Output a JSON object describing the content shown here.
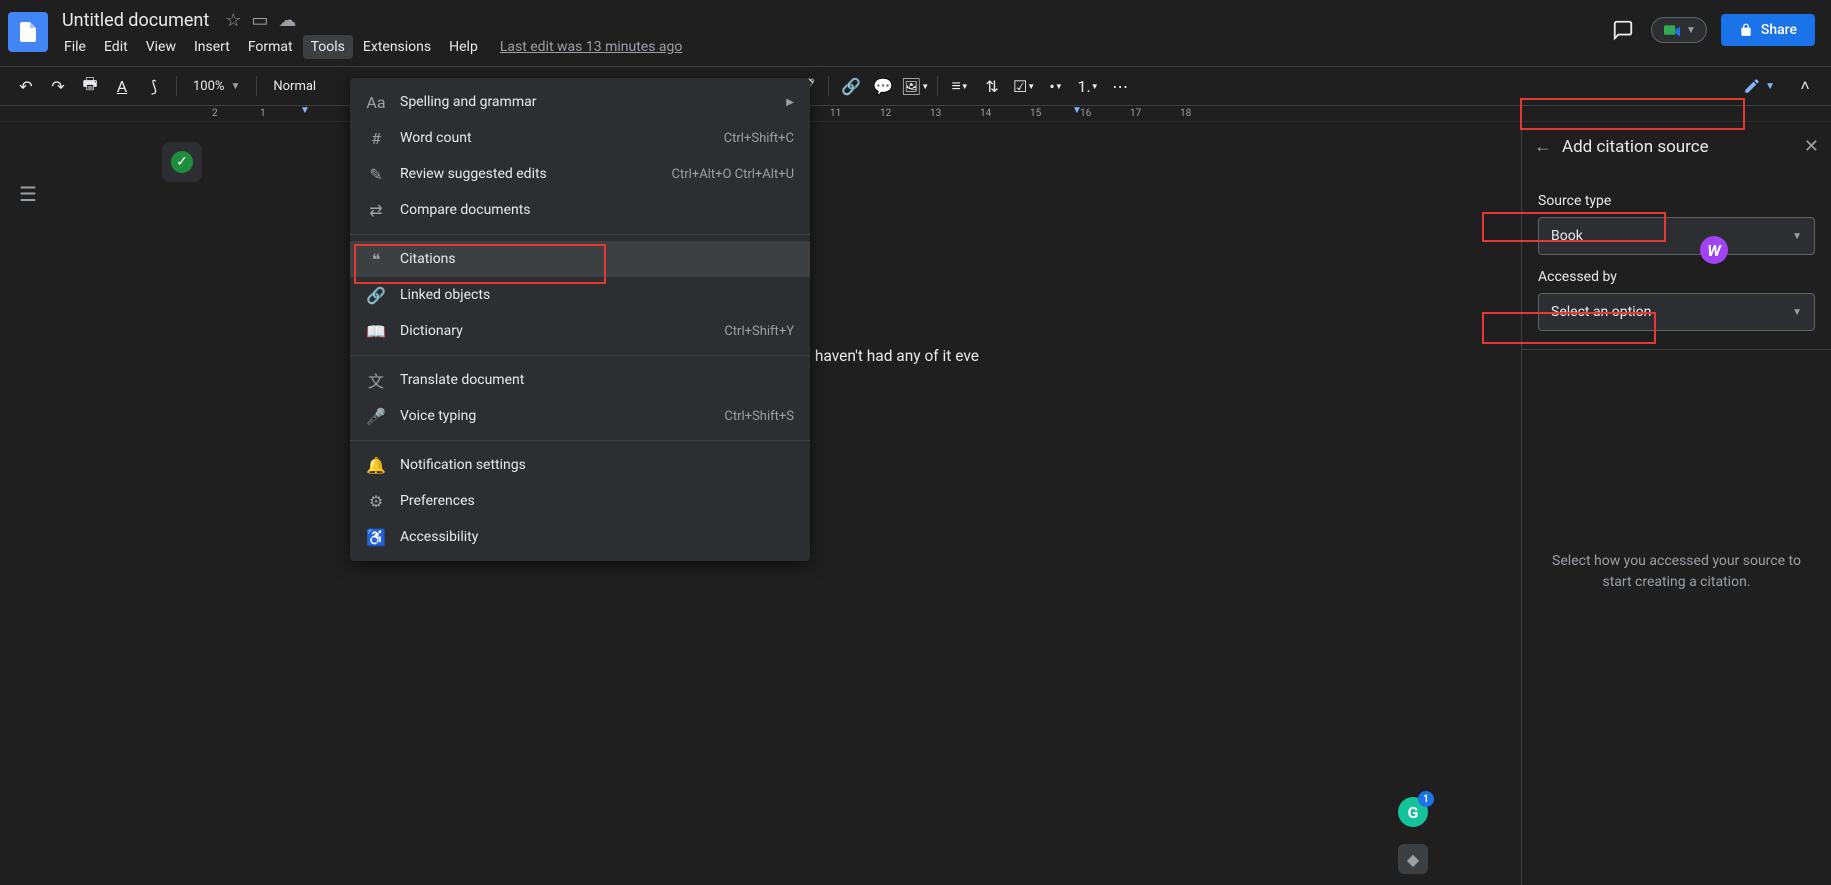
{
  "header": {
    "doc_title": "Untitled document",
    "menubar": [
      "File",
      "Edit",
      "View",
      "Insert",
      "Format",
      "Tools",
      "Extensions",
      "Help"
    ],
    "last_edit": "Last edit was 13 minutes ago",
    "share_label": "Share"
  },
  "toolbar": {
    "zoom": "100%",
    "style": "Normal"
  },
  "ruler_numbers": [
    "2",
    "1",
    "11",
    "12",
    "13",
    "14",
    "15",
    "16",
    "17",
    "18"
  ],
  "tools_menu": {
    "items": [
      {
        "icon": "Aa",
        "label": "Spelling and grammar",
        "shortcut": "",
        "arrow": true
      },
      {
        "icon": "#",
        "label": "Word count",
        "shortcut": "Ctrl+Shift+C"
      },
      {
        "icon": "✎",
        "label": "Review suggested edits",
        "shortcut": "Ctrl+Alt+O Ctrl+Alt+U"
      },
      {
        "icon": "⇄",
        "label": "Compare documents",
        "shortcut": ""
      },
      {
        "sep": true
      },
      {
        "icon": "❝",
        "label": "Citations",
        "shortcut": "",
        "highlight": true
      },
      {
        "icon": "🔗",
        "label": "Linked objects",
        "shortcut": ""
      },
      {
        "icon": "📖",
        "label": "Dictionary",
        "shortcut": "Ctrl+Shift+Y"
      },
      {
        "sep": true
      },
      {
        "icon": "文",
        "label": "Translate document",
        "shortcut": ""
      },
      {
        "icon": "🎤",
        "label": "Voice typing",
        "shortcut": "Ctrl+Shift+S"
      },
      {
        "sep": true
      },
      {
        "icon": "🔔",
        "label": "Notification settings",
        "shortcut": ""
      },
      {
        "icon": "⚙",
        "label": "Preferences",
        "shortcut": ""
      },
      {
        "icon": "♿",
        "label": "Accessibility",
        "shortcut": ""
      }
    ]
  },
  "document_text": "I wa                                                                                               sn't it? I haven't had any of it eve                                                                                                 is now. Do we decorate stories with",
  "side_panel": {
    "title": "Add citation source",
    "source_type_label": "Source type",
    "source_type_value": "Book",
    "accessed_by_label": "Accessed by",
    "accessed_by_value": "Select an option",
    "hint": "Select how you accessed your source to start creating a citation."
  },
  "badges": {
    "w": "W",
    "g": "G",
    "g_count": "1"
  }
}
